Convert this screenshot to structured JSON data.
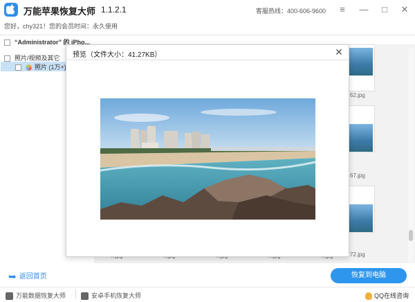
{
  "app": {
    "title": "万能苹果恢复大师",
    "version": "1.1.2.1",
    "hotline": "客服热线：400-606-9600"
  },
  "welcome": "您好，chy321！您的会员时间：永久使用",
  "tree": {
    "device": "“Administrator” 的 iPho...",
    "category": "照片/视频及其它",
    "photos": "照片 (1万+)"
  },
  "thumbs": {
    "names": [
      "62.jpg",
      "67.jpg",
      "72.jpg"
    ],
    "partial_names": [
      "...jpg",
      "...jpg",
      "...jpg",
      "...jpg",
      "...jpg"
    ]
  },
  "dialog": {
    "title": "预览（文件大小：41.27KB）"
  },
  "footer": {
    "back": "返回首页",
    "recover": "恢复到电脑",
    "item1": "万能数据恢复大师",
    "item2": "安卓手机恢复大师",
    "qq": "QQ在线咨询"
  },
  "colors": {
    "accent": "#2f96ee",
    "selection": "#c9e1f6"
  }
}
